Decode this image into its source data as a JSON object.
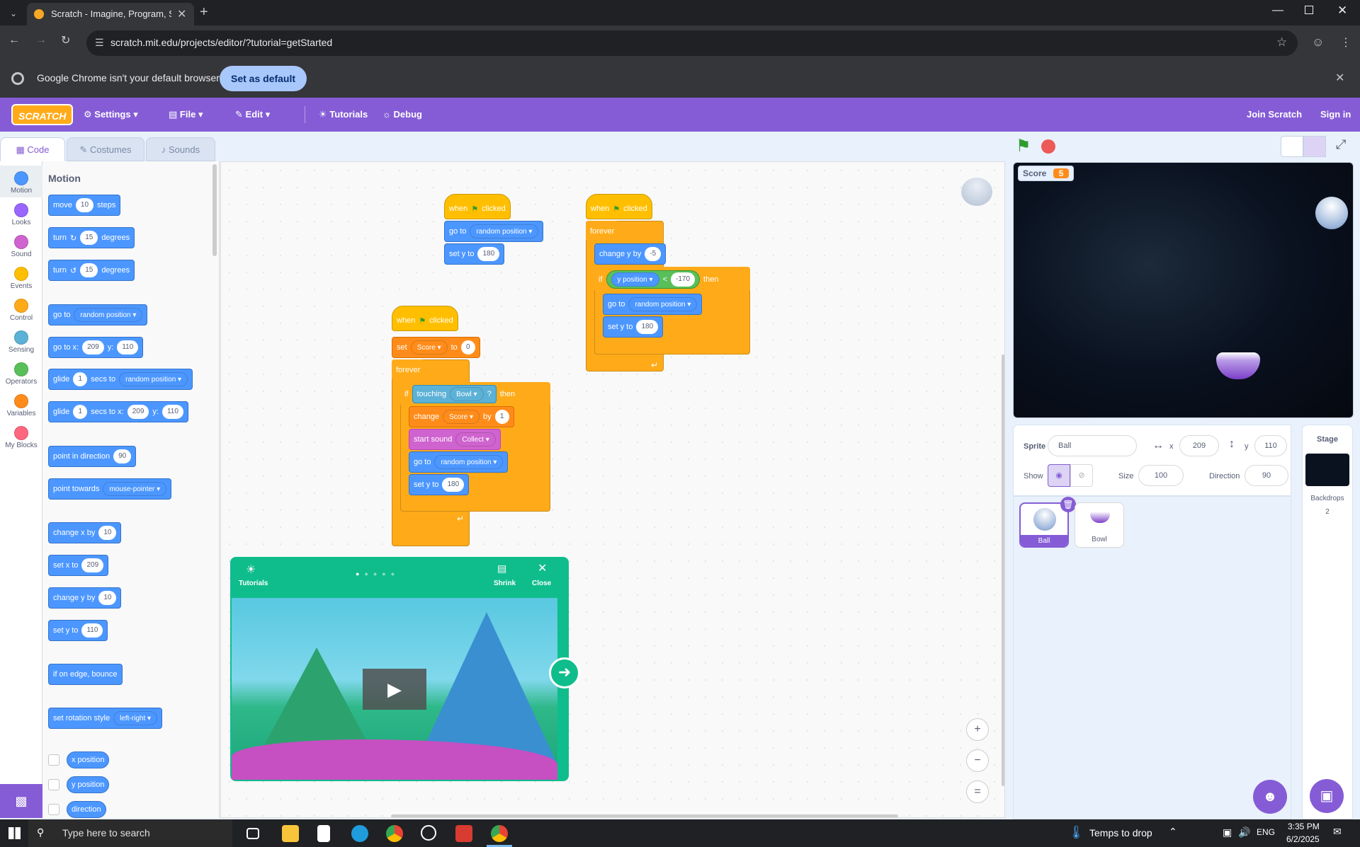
{
  "browser": {
    "tab_title": "Scratch - Imagine, Program, Sh",
    "url": "scratch.mit.edu/projects/editor/?tutorial=getStarted",
    "infobar_text": "Google Chrome isn't your default browser",
    "set_default_label": "Set as default"
  },
  "menu": {
    "logo": "SCRATCH",
    "settings": "Settings",
    "file": "File",
    "edit": "Edit",
    "tutorials": "Tutorials",
    "debug": "Debug",
    "join": "Join Scratch",
    "signin": "Sign in"
  },
  "editor_tabs": {
    "code": "Code",
    "costumes": "Costumes",
    "sounds": "Sounds"
  },
  "categories": [
    {
      "label": "Motion",
      "color": "#4c97ff"
    },
    {
      "label": "Looks",
      "color": "#9966ff"
    },
    {
      "label": "Sound",
      "color": "#cf63cf"
    },
    {
      "label": "Events",
      "color": "#ffbf00"
    },
    {
      "label": "Control",
      "color": "#ffab19"
    },
    {
      "label": "Sensing",
      "color": "#5cb1d6"
    },
    {
      "label": "Operators",
      "color": "#59c059"
    },
    {
      "label": "Variables",
      "color": "#ff8c1a"
    },
    {
      "label": "My Blocks",
      "color": "#ff6680"
    }
  ],
  "palette": {
    "heading": "Motion",
    "move": "move",
    "move_val": "10",
    "steps": "steps",
    "turn": "turn",
    "turn_val": "15",
    "degrees": "degrees",
    "goto": "go to",
    "random_position": "random position",
    "goto_x": "go to x:",
    "x_val": "209",
    "y_lbl": "y:",
    "y_val": "110",
    "glide": "glide",
    "glide_val": "1",
    "secs_to": "secs to",
    "secs_to_x": "secs to x:",
    "point_in_direction": "point in direction",
    "dir_val": "90",
    "point_towards": "point towards",
    "mouse_pointer": "mouse-pointer",
    "change_x_by": "change x by",
    "set_x_to": "set x to",
    "change_y_by": "change y by",
    "set_y_to": "set y to",
    "if_on_edge": "if on edge, bounce",
    "set_rotation_style": "set rotation style",
    "left_right": "left-right",
    "x_position": "x position",
    "y_position": "y position",
    "direction": "direction"
  },
  "scripts": {
    "when": "when",
    "clicked": "clicked",
    "go_to": "go to",
    "random_position": "random position",
    "set_y_to": "set y to",
    "y180": "180",
    "forever": "forever",
    "change_y_by": "change y by",
    "minus5": "-5",
    "if": "if",
    "y_position": "y position",
    "lt": "<",
    "minus170": "-170",
    "then": "then",
    "set": "set",
    "score": "Score",
    "to": "to",
    "zero": "0",
    "touching": "touching",
    "bowl": "Bowl",
    "q": "?",
    "change": "change",
    "by": "by",
    "one": "1",
    "start_sound": "start sound",
    "collect": "Collect"
  },
  "tutorial": {
    "label": "Tutorials",
    "shrink": "Shrink",
    "close": "Close"
  },
  "stage": {
    "score_label": "Score",
    "score_value": "5"
  },
  "sprite_info": {
    "sprite_label": "Sprite",
    "sprite_name": "Ball",
    "x_label": "x",
    "x": "209",
    "y_label": "y",
    "y": "110",
    "show_label": "Show",
    "size_label": "Size",
    "size": "100",
    "direction_label": "Direction",
    "direction": "90"
  },
  "sprites": [
    {
      "name": "Ball"
    },
    {
      "name": "Bowl"
    }
  ],
  "stage_pane": {
    "label": "Stage",
    "backdrops_label": "Backdrops",
    "backdrops_count": "2"
  },
  "taskbar": {
    "search_placeholder": "Type here to search",
    "weather": "Temps to drop",
    "lang": "ENG",
    "time": "3:35 PM",
    "date": "6/2/2025"
  }
}
